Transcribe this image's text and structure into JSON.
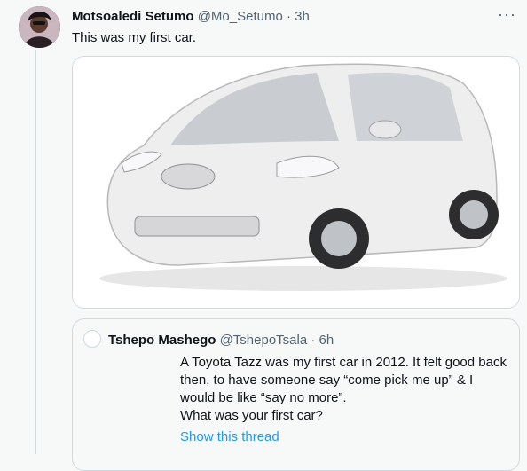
{
  "tweet": {
    "display_name": "Motsoaledi Setumo",
    "handle": "@Mo_Setumo",
    "separator": "·",
    "time": "3h",
    "text": "This was my first car.",
    "more_icon": "more-icon"
  },
  "media": {
    "icon": "car-photo",
    "color": "#ffffff"
  },
  "quote": {
    "display_name": "Tshepo Mashego",
    "handle": "@TshepoTsala",
    "separator": "·",
    "time": "6h",
    "lines": [
      "A Toyota Tazz was my first car in 2012. It felt good back",
      "then, to have someone say “come pick me up” & I",
      "would be like “say no more”.",
      "What was your first car?"
    ],
    "show_thread": "Show this thread"
  },
  "colors": {
    "link": "#1d9bf0",
    "muted": "#536471",
    "border": "#cfd9de"
  }
}
